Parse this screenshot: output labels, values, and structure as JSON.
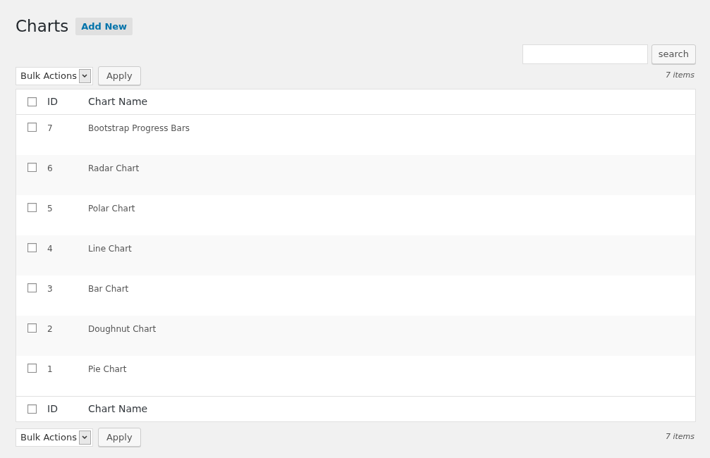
{
  "title": "Charts",
  "add_new": "Add New",
  "search": {
    "button": "search"
  },
  "top_nav": {
    "bulk_actions": "Bulk Actions",
    "apply": "Apply",
    "count": "7 items"
  },
  "table": {
    "header": {
      "checked": false,
      "columns": [
        "ID",
        "Chart Name"
      ]
    },
    "rows": [
      {
        "checked": false,
        "id": "7",
        "name": "Bootstrap Progress Bars"
      },
      {
        "checked": false,
        "id": "6",
        "name": "Radar Chart"
      },
      {
        "checked": false,
        "id": "5",
        "name": "Polar Chart"
      },
      {
        "checked": false,
        "id": "4",
        "name": "Line Chart"
      },
      {
        "checked": false,
        "id": "3",
        "name": "Bar Chart"
      },
      {
        "checked": false,
        "id": "2",
        "name": "Doughnut Chart"
      },
      {
        "checked": false,
        "id": "1",
        "name": "Pie Chart"
      }
    ],
    "footer": {
      "checked": false,
      "columns": [
        "ID",
        "Chart Name"
      ]
    }
  },
  "bottom_nav": {
    "bulk_actions": "Bulk Actions",
    "apply": "Apply",
    "count": "7 items"
  }
}
